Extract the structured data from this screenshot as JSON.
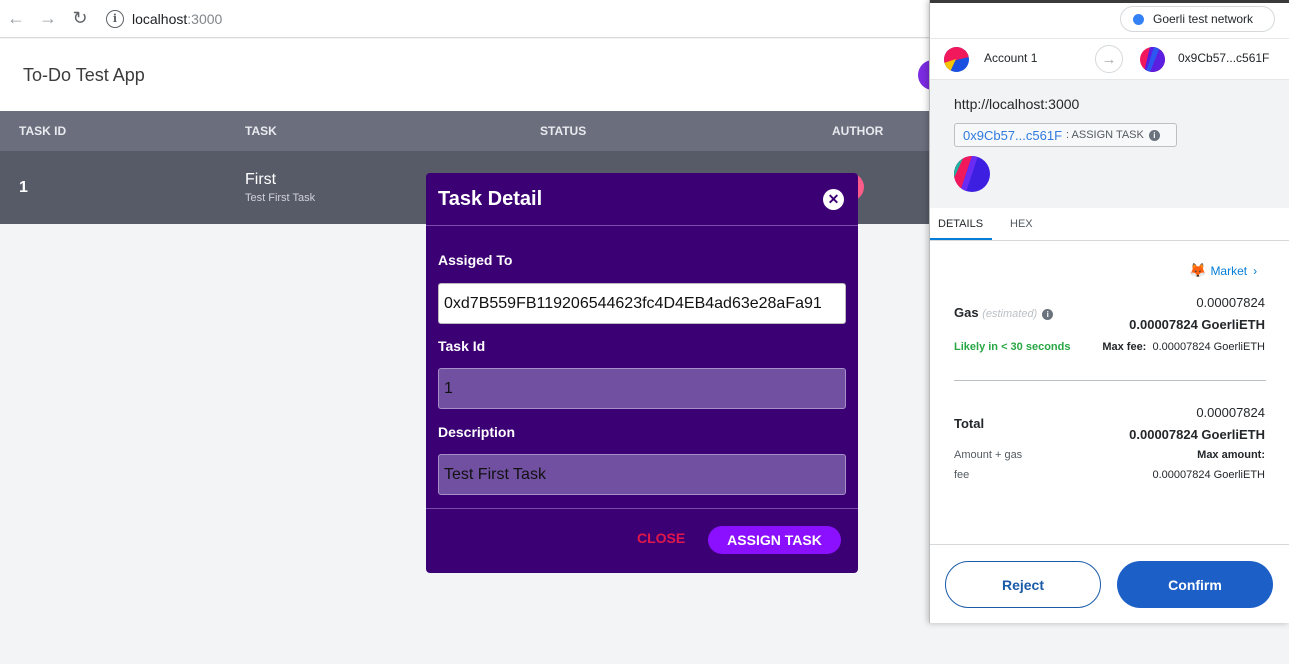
{
  "browser": {
    "url_host": "localhost",
    "url_port": ":3000"
  },
  "app": {
    "title": "To-Do Test App"
  },
  "table": {
    "headers": [
      "TASK ID",
      "TASK",
      "STATUS",
      "AUTHOR"
    ],
    "rows": [
      {
        "id": "1",
        "title": "First",
        "description": "Test First Task"
      }
    ]
  },
  "modal": {
    "title": "Task Detail",
    "assigned_label": "Assiged To",
    "assigned_value": "0xd7B559FB119206544623fc4D4EB4ad63e28aFa91",
    "taskid_label": "Task Id",
    "taskid_value": "1",
    "description_label": "Description",
    "description_value": "Test First Task",
    "close_label": "CLOSE",
    "assign_label": "ASSIGN TASK"
  },
  "metamask": {
    "network": "Goerli test network",
    "from_account": "Account 1",
    "to_account": "0x9Cb57...c561F",
    "origin": "http://localhost:3000",
    "method_address": "0x9Cb57...c561F",
    "method_name": ": ASSIGN TASK",
    "tabs": [
      "DETAILS",
      "HEX"
    ],
    "market_label": "Market",
    "gas_label": "Gas",
    "gas_estimated": "(estimated)",
    "gas_value_small": "0.00007824",
    "gas_value_bold": "0.00007824 GoerliETH",
    "likely_text": "Likely in < 30 seconds",
    "max_fee_label": "Max fee:",
    "max_fee_value": "0.00007824 GoerliETH",
    "total_label": "Total",
    "total_value_small": "0.00007824",
    "total_value_bold": "0.00007824 GoerliETH",
    "amount_gas_label": "Amount + gas",
    "fee_label": "fee",
    "max_amount_label": "Max amount:",
    "max_amount_value": "0.00007824 GoerliETH",
    "reject_label": "Reject",
    "confirm_label": "Confirm"
  }
}
